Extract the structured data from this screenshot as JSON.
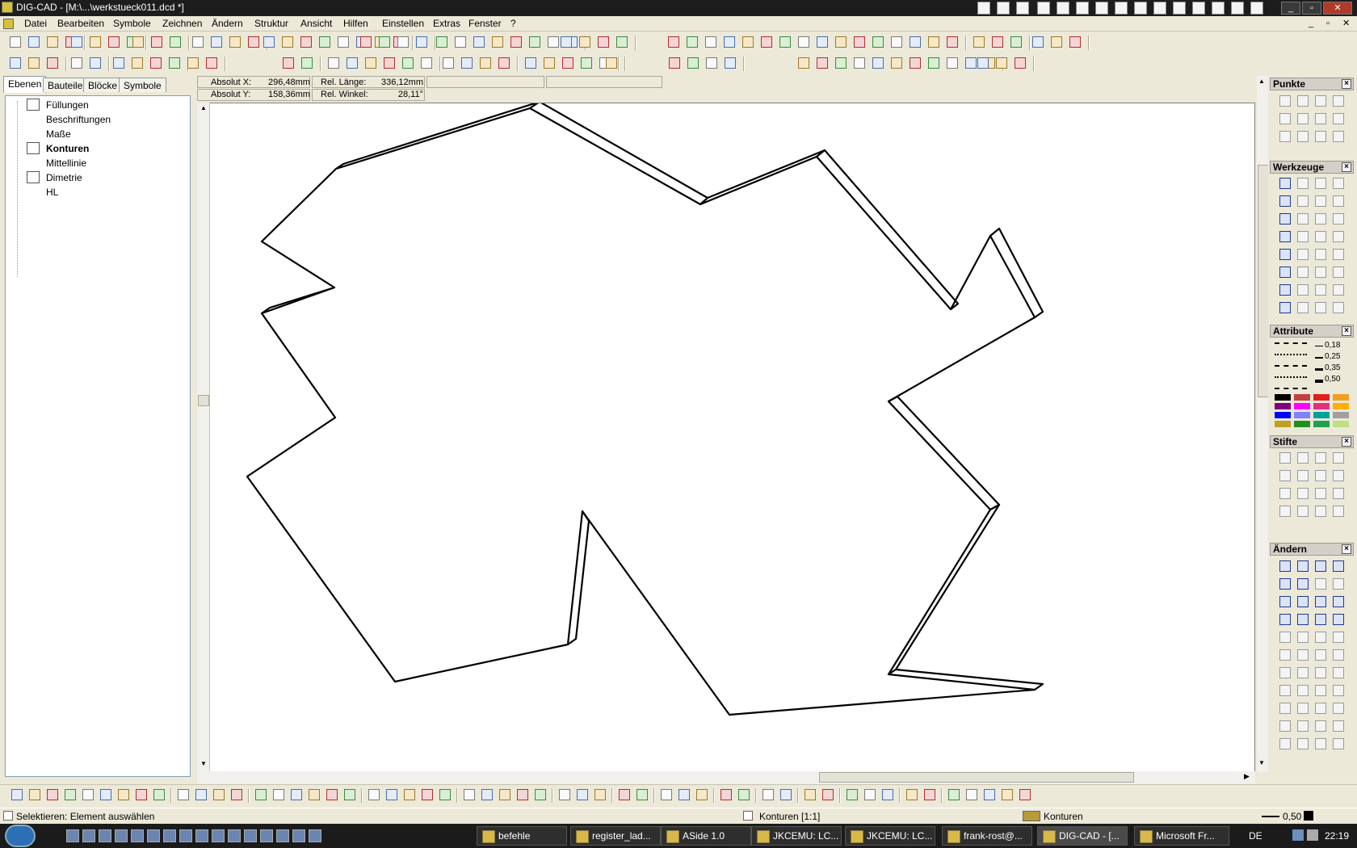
{
  "window": {
    "title": "DIG-CAD - [M:\\...\\werkstueck011.dcd *]"
  },
  "menu": [
    "Datei",
    "Bearbeiten",
    "Symbole",
    "Zeichnen",
    "Ändern",
    "Struktur",
    "Ansicht",
    "Hilfen",
    "Einstellen",
    "Extras",
    "Fenster",
    "?"
  ],
  "left_tabs": [
    "Ebenen",
    "Bauteile",
    "Blöcke",
    "Symbole"
  ],
  "layers": [
    {
      "name": "Füllungen",
      "bold": false,
      "icon": true
    },
    {
      "name": "Beschriftungen",
      "bold": false,
      "icon": false
    },
    {
      "name": "Maße",
      "bold": false,
      "icon": false
    },
    {
      "name": "Konturen",
      "bold": true,
      "icon": true
    },
    {
      "name": "Mittellinie",
      "bold": false,
      "icon": false
    },
    {
      "name": "Dimetrie",
      "bold": false,
      "icon": true
    },
    {
      "name": "HL",
      "bold": false,
      "icon": false
    }
  ],
  "coords": {
    "abs_x_label": "Absolut X:",
    "abs_x": "296,48mm",
    "abs_y_label": "Absolut Y:",
    "abs_y": "158,36mm",
    "rel_len_label": "Rel. Länge:",
    "rel_len": "336,12mm",
    "rel_ang_label": "Rel. Winkel:",
    "rel_ang": "28,11°"
  },
  "panels": {
    "punkte": "Punkte",
    "werkzeuge": "Werkzeuge",
    "attribute": "Attribute",
    "stifte": "Stifte",
    "aendern": "Ändern"
  },
  "line_widths": [
    "0,18",
    "0,25",
    "0,35",
    "0,50"
  ],
  "palette": [
    "#000000",
    "#c04040",
    "#e02020",
    "#f0a020",
    "#800080",
    "#ff00ff",
    "#e03080",
    "#ffb000",
    "#0000ff",
    "#8080ff",
    "#00a0a0",
    "#a0a0a0",
    "#c0a020",
    "#209020",
    "#20a050",
    "#c0e080"
  ],
  "status": {
    "hint": "Selektieren: Element auswählen",
    "layer_scale": "Konturen [1:1]",
    "layer": "Konturen",
    "width": "0,50"
  },
  "taskbar": {
    "tasks": [
      "befehle",
      "register_lad...",
      "ASide 1.0",
      "JKCEMU: LC...",
      "JKCEMU: LC...",
      "frank-rost@...",
      "DIG-CAD - [...",
      "Microsoft Fr..."
    ],
    "lang": "DE",
    "time": "22:19"
  },
  "icons": {
    "app": "dig-cad-icon",
    "start": "windows-start-icon"
  }
}
